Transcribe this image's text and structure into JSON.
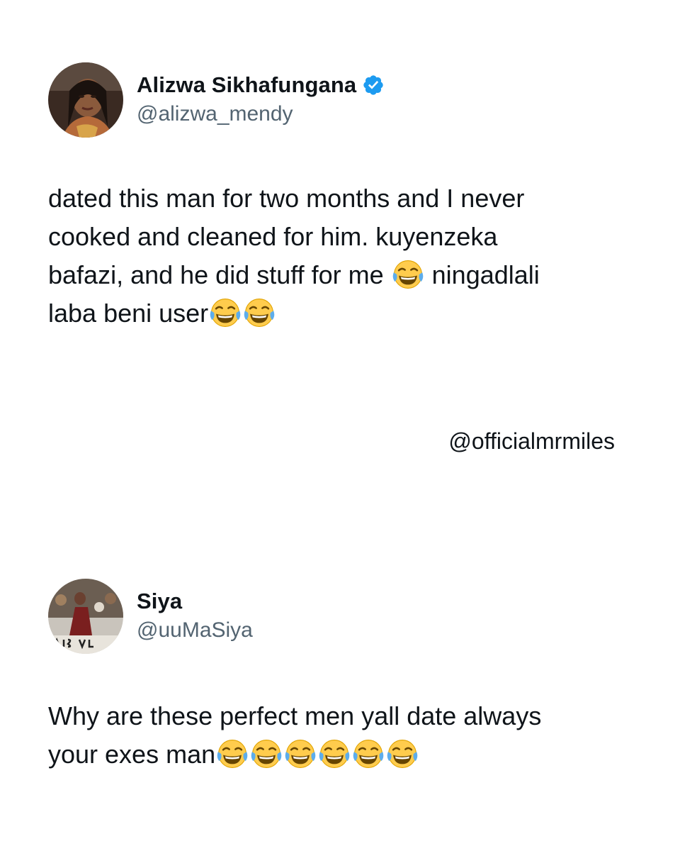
{
  "tweets": [
    {
      "display_name": "Alizwa Sikhafungana",
      "verified": true,
      "handle": "@alizwa_mendy",
      "text_lines": [
        "dated this man for two months and I never",
        "cooked and cleaned for him. kuyenzeka",
        "bafazi, and he did stuff for me",
        "ningadlali",
        "laba beni user"
      ],
      "avatar_icon": "person-avatar"
    },
    {
      "display_name": "Siya",
      "verified": false,
      "handle": "@uuMaSiya",
      "text_lines": [
        "Why are these perfect men yall date always",
        "your exes man"
      ],
      "avatar_icon": "person-avatar"
    }
  ],
  "watermark": "@officialmrmiles",
  "emoji_name": "face-with-tears-of-joy-icon",
  "colors": {
    "text": "#0f1419",
    "secondary_text": "#536471",
    "verified_blue": "#1d9bf0",
    "background": "#ffffff"
  }
}
